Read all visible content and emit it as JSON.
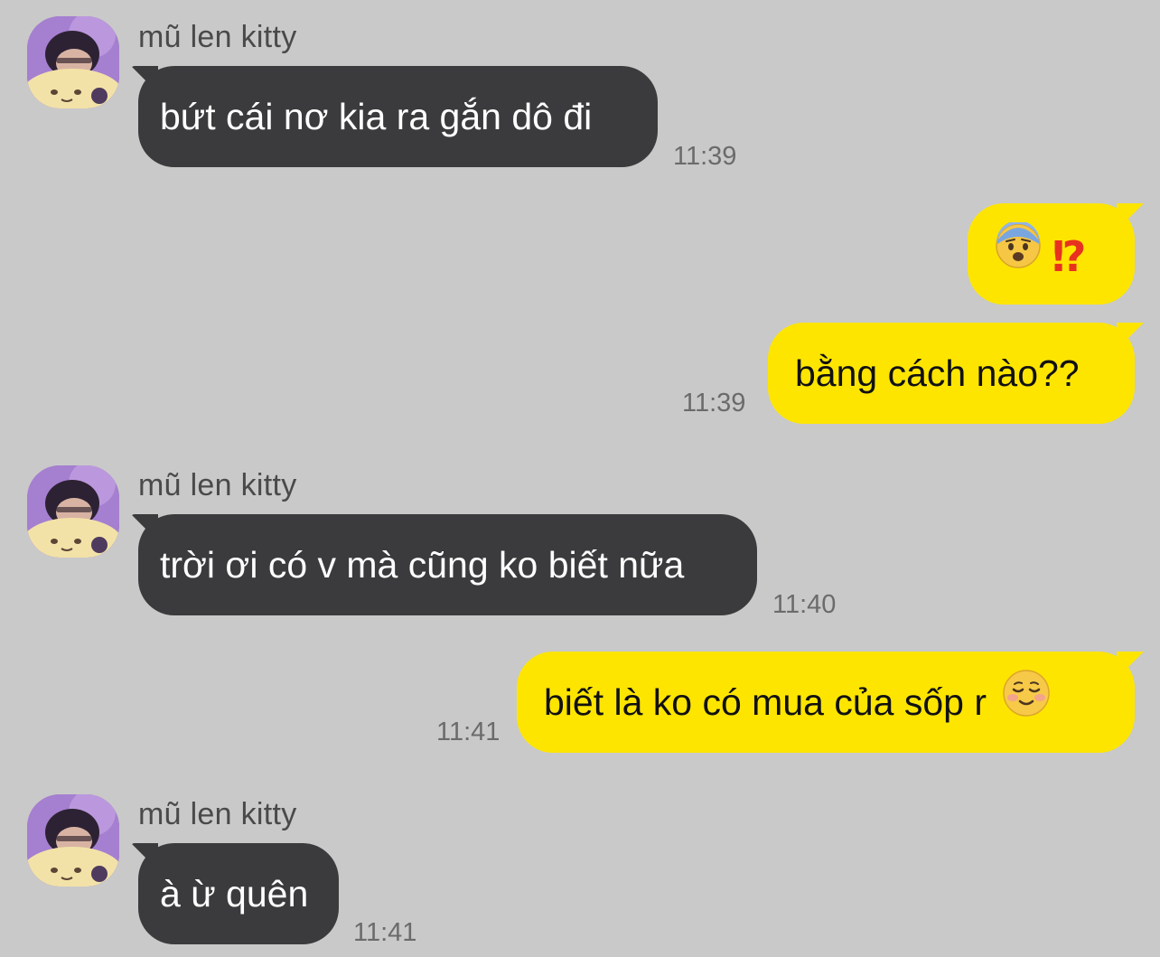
{
  "chat": {
    "contact_name": "mũ len kitty",
    "messages": [
      {
        "side": "in",
        "sender": "mũ len kitty",
        "text": "bứt cái nơ kia ra gắn dô đi",
        "time": "11:39"
      },
      {
        "side": "out",
        "text": "",
        "emoji": "anxious-face-with-sweat + ⁉",
        "emoji_text": "⁉",
        "time": ""
      },
      {
        "side": "out",
        "text": "bằng cách nào??",
        "time": "11:39"
      },
      {
        "side": "in",
        "sender": "mũ len kitty",
        "text": "trời ơi có v mà cũng ko biết nữa",
        "time": "11:40"
      },
      {
        "side": "out",
        "text": "biết là ko có mua của sốp r",
        "emoji": "smiling-face",
        "time": "11:41"
      },
      {
        "side": "in",
        "sender": "mũ len kitty",
        "text": "à ừ quên",
        "time": "11:41"
      }
    ]
  },
  "colors": {
    "background": "#c9c9c9",
    "incoming_bubble": "#3b3b3d",
    "outgoing_bubble": "#fee500"
  }
}
